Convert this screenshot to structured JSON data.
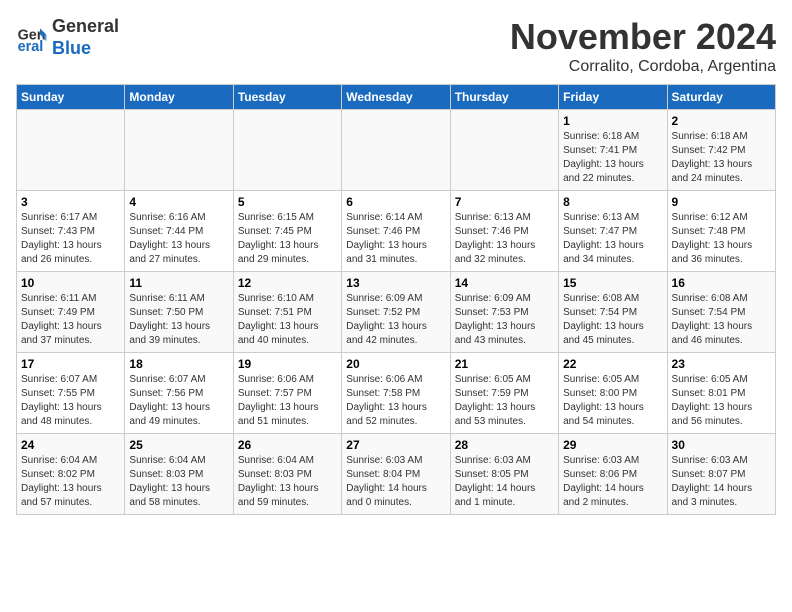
{
  "logo": {
    "line1": "General",
    "line2": "Blue"
  },
  "title": "November 2024",
  "subtitle": "Corralito, Cordoba, Argentina",
  "days_of_week": [
    "Sunday",
    "Monday",
    "Tuesday",
    "Wednesday",
    "Thursday",
    "Friday",
    "Saturday"
  ],
  "weeks": [
    [
      {
        "day": "",
        "info": ""
      },
      {
        "day": "",
        "info": ""
      },
      {
        "day": "",
        "info": ""
      },
      {
        "day": "",
        "info": ""
      },
      {
        "day": "",
        "info": ""
      },
      {
        "day": "1",
        "info": "Sunrise: 6:18 AM\nSunset: 7:41 PM\nDaylight: 13 hours\nand 22 minutes."
      },
      {
        "day": "2",
        "info": "Sunrise: 6:18 AM\nSunset: 7:42 PM\nDaylight: 13 hours\nand 24 minutes."
      }
    ],
    [
      {
        "day": "3",
        "info": "Sunrise: 6:17 AM\nSunset: 7:43 PM\nDaylight: 13 hours\nand 26 minutes."
      },
      {
        "day": "4",
        "info": "Sunrise: 6:16 AM\nSunset: 7:44 PM\nDaylight: 13 hours\nand 27 minutes."
      },
      {
        "day": "5",
        "info": "Sunrise: 6:15 AM\nSunset: 7:45 PM\nDaylight: 13 hours\nand 29 minutes."
      },
      {
        "day": "6",
        "info": "Sunrise: 6:14 AM\nSunset: 7:46 PM\nDaylight: 13 hours\nand 31 minutes."
      },
      {
        "day": "7",
        "info": "Sunrise: 6:13 AM\nSunset: 7:46 PM\nDaylight: 13 hours\nand 32 minutes."
      },
      {
        "day": "8",
        "info": "Sunrise: 6:13 AM\nSunset: 7:47 PM\nDaylight: 13 hours\nand 34 minutes."
      },
      {
        "day": "9",
        "info": "Sunrise: 6:12 AM\nSunset: 7:48 PM\nDaylight: 13 hours\nand 36 minutes."
      }
    ],
    [
      {
        "day": "10",
        "info": "Sunrise: 6:11 AM\nSunset: 7:49 PM\nDaylight: 13 hours\nand 37 minutes."
      },
      {
        "day": "11",
        "info": "Sunrise: 6:11 AM\nSunset: 7:50 PM\nDaylight: 13 hours\nand 39 minutes."
      },
      {
        "day": "12",
        "info": "Sunrise: 6:10 AM\nSunset: 7:51 PM\nDaylight: 13 hours\nand 40 minutes."
      },
      {
        "day": "13",
        "info": "Sunrise: 6:09 AM\nSunset: 7:52 PM\nDaylight: 13 hours\nand 42 minutes."
      },
      {
        "day": "14",
        "info": "Sunrise: 6:09 AM\nSunset: 7:53 PM\nDaylight: 13 hours\nand 43 minutes."
      },
      {
        "day": "15",
        "info": "Sunrise: 6:08 AM\nSunset: 7:54 PM\nDaylight: 13 hours\nand 45 minutes."
      },
      {
        "day": "16",
        "info": "Sunrise: 6:08 AM\nSunset: 7:54 PM\nDaylight: 13 hours\nand 46 minutes."
      }
    ],
    [
      {
        "day": "17",
        "info": "Sunrise: 6:07 AM\nSunset: 7:55 PM\nDaylight: 13 hours\nand 48 minutes."
      },
      {
        "day": "18",
        "info": "Sunrise: 6:07 AM\nSunset: 7:56 PM\nDaylight: 13 hours\nand 49 minutes."
      },
      {
        "day": "19",
        "info": "Sunrise: 6:06 AM\nSunset: 7:57 PM\nDaylight: 13 hours\nand 51 minutes."
      },
      {
        "day": "20",
        "info": "Sunrise: 6:06 AM\nSunset: 7:58 PM\nDaylight: 13 hours\nand 52 minutes."
      },
      {
        "day": "21",
        "info": "Sunrise: 6:05 AM\nSunset: 7:59 PM\nDaylight: 13 hours\nand 53 minutes."
      },
      {
        "day": "22",
        "info": "Sunrise: 6:05 AM\nSunset: 8:00 PM\nDaylight: 13 hours\nand 54 minutes."
      },
      {
        "day": "23",
        "info": "Sunrise: 6:05 AM\nSunset: 8:01 PM\nDaylight: 13 hours\nand 56 minutes."
      }
    ],
    [
      {
        "day": "24",
        "info": "Sunrise: 6:04 AM\nSunset: 8:02 PM\nDaylight: 13 hours\nand 57 minutes."
      },
      {
        "day": "25",
        "info": "Sunrise: 6:04 AM\nSunset: 8:03 PM\nDaylight: 13 hours\nand 58 minutes."
      },
      {
        "day": "26",
        "info": "Sunrise: 6:04 AM\nSunset: 8:03 PM\nDaylight: 13 hours\nand 59 minutes."
      },
      {
        "day": "27",
        "info": "Sunrise: 6:03 AM\nSunset: 8:04 PM\nDaylight: 14 hours\nand 0 minutes."
      },
      {
        "day": "28",
        "info": "Sunrise: 6:03 AM\nSunset: 8:05 PM\nDaylight: 14 hours\nand 1 minute."
      },
      {
        "day": "29",
        "info": "Sunrise: 6:03 AM\nSunset: 8:06 PM\nDaylight: 14 hours\nand 2 minutes."
      },
      {
        "day": "30",
        "info": "Sunrise: 6:03 AM\nSunset: 8:07 PM\nDaylight: 14 hours\nand 3 minutes."
      }
    ]
  ]
}
